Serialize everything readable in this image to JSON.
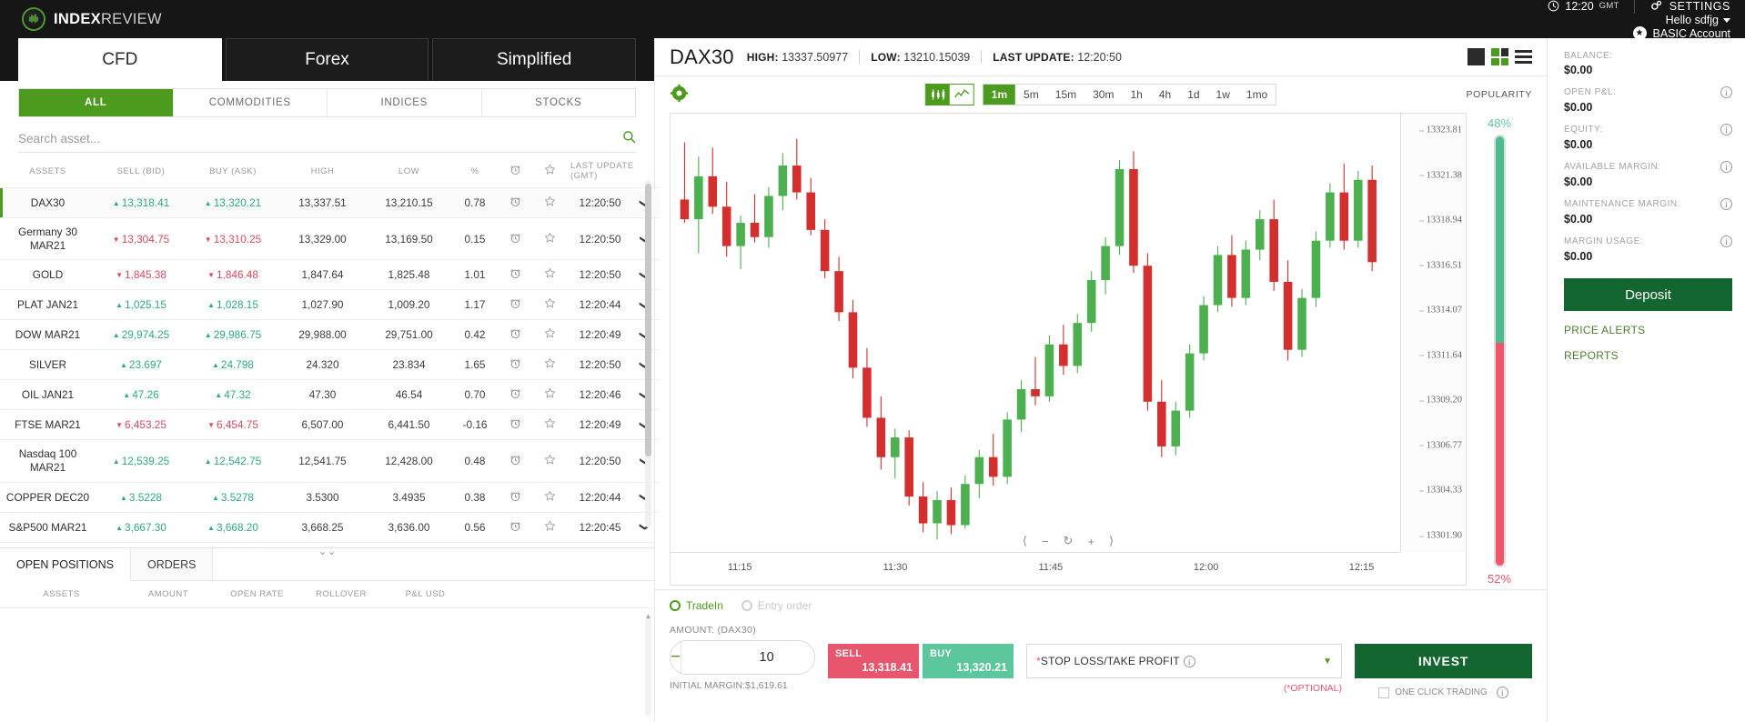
{
  "brand": {
    "bold": "INDEX",
    "light": "REVIEW"
  },
  "header": {
    "time": "12:20",
    "gmt": "GMT",
    "settings": "SETTINGS",
    "greeting": "Hello sdfjg",
    "account_type": "BASIC Account"
  },
  "main_tabs": [
    {
      "label": "CFD",
      "active": true
    },
    {
      "label": "Forex",
      "active": false
    },
    {
      "label": "Simplified",
      "active": false
    }
  ],
  "category_tabs": [
    {
      "label": "ALL",
      "active": true
    },
    {
      "label": "COMMODITIES",
      "active": false
    },
    {
      "label": "INDICES",
      "active": false
    },
    {
      "label": "STOCKS",
      "active": false
    }
  ],
  "search": {
    "placeholder": "Search asset...",
    "value": ""
  },
  "asset_table": {
    "columns": [
      "ASSETS",
      "SELL (BID)",
      "BUY (ASK)",
      "HIGH",
      "LOW",
      "%",
      "LAST UPDATE (GMT)"
    ],
    "last_update_header_line1": "LAST UPDATE",
    "last_update_header_line2": "(GMT)",
    "rows": [
      {
        "name": "DAX30",
        "name2": "",
        "sell": "13,318.41",
        "buy": "13,320.21",
        "high": "13,337.51",
        "low": "13,210.15",
        "pct": "0.78",
        "updated": "12:20:50",
        "dir": "up",
        "selected": true
      },
      {
        "name": "Germany 30",
        "name2": "MAR21",
        "sell": "13,304.75",
        "buy": "13,310.25",
        "high": "13,329.00",
        "low": "13,169.50",
        "pct": "0.15",
        "updated": "12:20:50",
        "dir": "down",
        "selected": false
      },
      {
        "name": "GOLD",
        "name2": "",
        "sell": "1,845.38",
        "buy": "1,846.48",
        "high": "1,847.64",
        "low": "1,825.48",
        "pct": "1.01",
        "updated": "12:20:50",
        "dir": "down",
        "selected": false
      },
      {
        "name": "PLAT JAN21",
        "name2": "",
        "sell": "1,025.15",
        "buy": "1,028.15",
        "high": "1,027.90",
        "low": "1,009.20",
        "pct": "1.17",
        "updated": "12:20:44",
        "dir": "up",
        "selected": false
      },
      {
        "name": "DOW MAR21",
        "name2": "",
        "sell": "29,974.25",
        "buy": "29,986.75",
        "high": "29,988.00",
        "low": "29,751.00",
        "pct": "0.42",
        "updated": "12:20:49",
        "dir": "up",
        "selected": false
      },
      {
        "name": "SILVER",
        "name2": "",
        "sell": "23.697",
        "buy": "24.798",
        "high": "24.320",
        "low": "23.834",
        "pct": "1.65",
        "updated": "12:20:50",
        "dir": "up",
        "selected": false
      },
      {
        "name": "OIL JAN21",
        "name2": "",
        "sell": "47.26",
        "buy": "47.32",
        "high": "47.30",
        "low": "46.54",
        "pct": "0.70",
        "updated": "12:20:46",
        "dir": "up",
        "selected": false
      },
      {
        "name": "FTSE MAR21",
        "name2": "",
        "sell": "6,453.25",
        "buy": "6,454.75",
        "high": "6,507.00",
        "low": "6,441.50",
        "pct": "-0.16",
        "updated": "12:20:49",
        "dir": "down",
        "selected": false
      },
      {
        "name": "Nasdaq 100",
        "name2": "MAR21",
        "sell": "12,539.25",
        "buy": "12,542.75",
        "high": "12,541.75",
        "low": "12,428.00",
        "pct": "0.48",
        "updated": "12:20:50",
        "dir": "up",
        "selected": false
      },
      {
        "name": "COPPER DEC20",
        "name2": "",
        "sell": "3.5228",
        "buy": "3.5278",
        "high": "3.5300",
        "low": "3.4935",
        "pct": "0.38",
        "updated": "12:20:44",
        "dir": "up",
        "selected": false
      },
      {
        "name": "S&P500 MAR21",
        "name2": "",
        "sell": "3,667.30",
        "buy": "3,668.20",
        "high": "3,668.25",
        "low": "3,636.00",
        "pct": "0.56",
        "updated": "12:20:45",
        "dir": "up",
        "selected": false
      }
    ]
  },
  "positions": {
    "tabs": [
      {
        "label": "OPEN POSITIONS",
        "active": true
      },
      {
        "label": "ORDERS",
        "active": false
      }
    ],
    "columns": [
      "ASSETS",
      "AMOUNT",
      "OPEN RATE",
      "ROLLOVER",
      "P&L USD"
    ]
  },
  "chart_header": {
    "symbol": "DAX30",
    "high_label": "HIGH:",
    "high_value": "13337.50977",
    "low_label": "LOW:",
    "low_value": "13210.15039",
    "last_update_label": "LAST UPDATE:",
    "last_update_value": "12:20:50"
  },
  "chart_toolbar": {
    "timeframes": [
      {
        "label": "1m",
        "active": true
      },
      {
        "label": "5m",
        "active": false
      },
      {
        "label": "15m",
        "active": false
      },
      {
        "label": "30m",
        "active": false
      },
      {
        "label": "1h",
        "active": false
      },
      {
        "label": "4h",
        "active": false
      },
      {
        "label": "1d",
        "active": false
      },
      {
        "label": "1w",
        "active": false
      },
      {
        "label": "1mo",
        "active": false
      }
    ],
    "popularity_label": "POPULARITY"
  },
  "popularity": {
    "buy_pct": "48%",
    "sell_pct": "52%",
    "buy_value": 48,
    "sell_value": 52
  },
  "chart_data": {
    "type": "candlestick",
    "title": "DAX30",
    "timeframe": "1m",
    "ylabel": "",
    "xlabel": "",
    "ylim": [
      13300.5,
      13325.0
    ],
    "y_ticks": [
      "13323.81",
      "13321.38",
      "13318.94",
      "13316.51",
      "13314.07",
      "13311.64",
      "13309.20",
      "13306.77",
      "13304.33",
      "13301.90"
    ],
    "x_ticks": [
      "11:15",
      "11:30",
      "11:45",
      "12:00",
      "12:15"
    ],
    "colors": {
      "up": "#4caf50",
      "down": "#d32f2f"
    },
    "candles": [
      {
        "o": 13320.2,
        "h": 13323.4,
        "l": 13318.9,
        "c": 13319.1,
        "d": "down"
      },
      {
        "o": 13319.1,
        "h": 13322.6,
        "l": 13317.2,
        "c": 13321.5,
        "d": "up"
      },
      {
        "o": 13321.5,
        "h": 13323.1,
        "l": 13319.4,
        "c": 13319.8,
        "d": "down"
      },
      {
        "o": 13319.8,
        "h": 13321.2,
        "l": 13317.0,
        "c": 13317.6,
        "d": "down"
      },
      {
        "o": 13317.6,
        "h": 13319.3,
        "l": 13316.3,
        "c": 13318.9,
        "d": "up"
      },
      {
        "o": 13318.9,
        "h": 13320.5,
        "l": 13317.8,
        "c": 13318.1,
        "d": "down"
      },
      {
        "o": 13318.1,
        "h": 13320.9,
        "l": 13317.5,
        "c": 13320.4,
        "d": "up"
      },
      {
        "o": 13320.4,
        "h": 13322.8,
        "l": 13319.6,
        "c": 13322.1,
        "d": "up"
      },
      {
        "o": 13322.1,
        "h": 13323.6,
        "l": 13320.2,
        "c": 13320.6,
        "d": "down"
      },
      {
        "o": 13320.6,
        "h": 13321.4,
        "l": 13318.2,
        "c": 13318.5,
        "d": "down"
      },
      {
        "o": 13318.5,
        "h": 13319.1,
        "l": 13315.8,
        "c": 13316.2,
        "d": "down"
      },
      {
        "o": 13316.2,
        "h": 13317.0,
        "l": 13313.4,
        "c": 13313.9,
        "d": "down"
      },
      {
        "o": 13313.9,
        "h": 13314.6,
        "l": 13310.2,
        "c": 13310.8,
        "d": "down"
      },
      {
        "o": 13310.8,
        "h": 13311.9,
        "l": 13307.5,
        "c": 13308.0,
        "d": "down"
      },
      {
        "o": 13308.0,
        "h": 13309.2,
        "l": 13305.1,
        "c": 13305.8,
        "d": "down"
      },
      {
        "o": 13305.8,
        "h": 13307.4,
        "l": 13304.6,
        "c": 13306.9,
        "d": "up"
      },
      {
        "o": 13306.9,
        "h": 13307.3,
        "l": 13303.1,
        "c": 13303.6,
        "d": "down"
      },
      {
        "o": 13303.6,
        "h": 13304.4,
        "l": 13301.6,
        "c": 13302.1,
        "d": "down"
      },
      {
        "o": 13302.1,
        "h": 13303.9,
        "l": 13301.2,
        "c": 13303.4,
        "d": "up"
      },
      {
        "o": 13303.4,
        "h": 13304.1,
        "l": 13301.5,
        "c": 13302.0,
        "d": "down"
      },
      {
        "o": 13302.0,
        "h": 13304.8,
        "l": 13301.8,
        "c": 13304.3,
        "d": "up"
      },
      {
        "o": 13304.3,
        "h": 13306.2,
        "l": 13303.5,
        "c": 13305.8,
        "d": "up"
      },
      {
        "o": 13305.8,
        "h": 13307.1,
        "l": 13304.2,
        "c": 13304.7,
        "d": "down"
      },
      {
        "o": 13304.7,
        "h": 13308.3,
        "l": 13304.3,
        "c": 13307.9,
        "d": "up"
      },
      {
        "o": 13307.9,
        "h": 13310.1,
        "l": 13307.2,
        "c": 13309.6,
        "d": "up"
      },
      {
        "o": 13309.6,
        "h": 13311.4,
        "l": 13308.7,
        "c": 13309.2,
        "d": "down"
      },
      {
        "o": 13309.2,
        "h": 13312.6,
        "l": 13308.9,
        "c": 13312.1,
        "d": "up"
      },
      {
        "o": 13312.1,
        "h": 13313.2,
        "l": 13310.4,
        "c": 13310.9,
        "d": "down"
      },
      {
        "o": 13310.9,
        "h": 13313.8,
        "l": 13310.5,
        "c": 13313.3,
        "d": "up"
      },
      {
        "o": 13313.3,
        "h": 13316.2,
        "l": 13312.8,
        "c": 13315.7,
        "d": "up"
      },
      {
        "o": 13315.7,
        "h": 13318.1,
        "l": 13314.9,
        "c": 13317.6,
        "d": "up"
      },
      {
        "o": 13317.6,
        "h": 13322.4,
        "l": 13317.1,
        "c": 13321.9,
        "d": "up"
      },
      {
        "o": 13321.9,
        "h": 13322.9,
        "l": 13316.1,
        "c": 13316.5,
        "d": "down"
      },
      {
        "o": 13316.5,
        "h": 13317.2,
        "l": 13308.4,
        "c": 13308.9,
        "d": "down"
      },
      {
        "o": 13308.9,
        "h": 13310.1,
        "l": 13305.8,
        "c": 13306.4,
        "d": "down"
      },
      {
        "o": 13306.4,
        "h": 13308.9,
        "l": 13305.9,
        "c": 13308.4,
        "d": "up"
      },
      {
        "o": 13308.4,
        "h": 13312.1,
        "l": 13308.0,
        "c": 13311.6,
        "d": "up"
      },
      {
        "o": 13311.6,
        "h": 13314.8,
        "l": 13311.2,
        "c": 13314.3,
        "d": "up"
      },
      {
        "o": 13314.3,
        "h": 13317.6,
        "l": 13313.9,
        "c": 13317.1,
        "d": "up"
      },
      {
        "o": 13317.1,
        "h": 13318.2,
        "l": 13314.2,
        "c": 13314.7,
        "d": "down"
      },
      {
        "o": 13314.7,
        "h": 13317.9,
        "l": 13314.3,
        "c": 13317.4,
        "d": "up"
      },
      {
        "o": 13317.4,
        "h": 13319.6,
        "l": 13316.8,
        "c": 13319.1,
        "d": "up"
      },
      {
        "o": 13319.1,
        "h": 13320.2,
        "l": 13315.1,
        "c": 13315.6,
        "d": "down"
      },
      {
        "o": 13315.6,
        "h": 13316.8,
        "l": 13311.2,
        "c": 13311.8,
        "d": "down"
      },
      {
        "o": 13311.8,
        "h": 13315.2,
        "l": 13311.4,
        "c": 13314.7,
        "d": "up"
      },
      {
        "o": 13314.7,
        "h": 13318.4,
        "l": 13314.2,
        "c": 13317.9,
        "d": "up"
      },
      {
        "o": 13317.9,
        "h": 13321.1,
        "l": 13317.5,
        "c": 13320.6,
        "d": "up"
      },
      {
        "o": 13320.6,
        "h": 13322.2,
        "l": 13317.4,
        "c": 13317.9,
        "d": "down"
      },
      {
        "o": 13317.9,
        "h": 13321.8,
        "l": 13317.5,
        "c": 13321.3,
        "d": "up"
      },
      {
        "o": 13321.3,
        "h": 13322.1,
        "l": 13316.2,
        "c": 13316.7,
        "d": "down"
      }
    ]
  },
  "trade": {
    "trade_in_label": "TradeIn",
    "entry_order_label": "Entry order",
    "amount_label": "AMOUNT: (DAX30)",
    "amount_value": "10",
    "minus": "−",
    "plus": "+",
    "initial_margin": "INITIAL MARGIN:$1,619.61",
    "sell_label": "SELL",
    "sell_price": "13,318.41",
    "buy_label": "BUY",
    "buy_price": "13,320.21",
    "sltp_label": "STOP LOSS/TAKE PROFIT",
    "optional_note": "(*OPTIONAL)",
    "invest_label": "INVEST",
    "one_click_label": "ONE CLICK TRADING"
  },
  "account": {
    "items": [
      {
        "label": "BALANCE:",
        "value": "$0.00",
        "info": false
      },
      {
        "label": "OPEN P&L:",
        "value": "$0.00",
        "info": true
      },
      {
        "label": "EQUITY:",
        "value": "$0.00",
        "info": true
      },
      {
        "label": "AVAILABLE MARGIN:",
        "value": "$0.00",
        "info": true
      },
      {
        "label": "MAINTENANCE MARGIN:",
        "value": "$0.00",
        "info": true
      },
      {
        "label": "MARGIN USAGE:",
        "value": "$0.00",
        "info": true
      }
    ],
    "deposit_label": "Deposit",
    "links": [
      "PRICE ALERTS",
      "REPORTS"
    ]
  },
  "colors": {
    "green": "#4d9b1e",
    "dark_green": "#13662f",
    "up": "#2eaa7e",
    "down": "#d84a5e",
    "sell": "#e8566e",
    "buy": "#5cc79c"
  }
}
